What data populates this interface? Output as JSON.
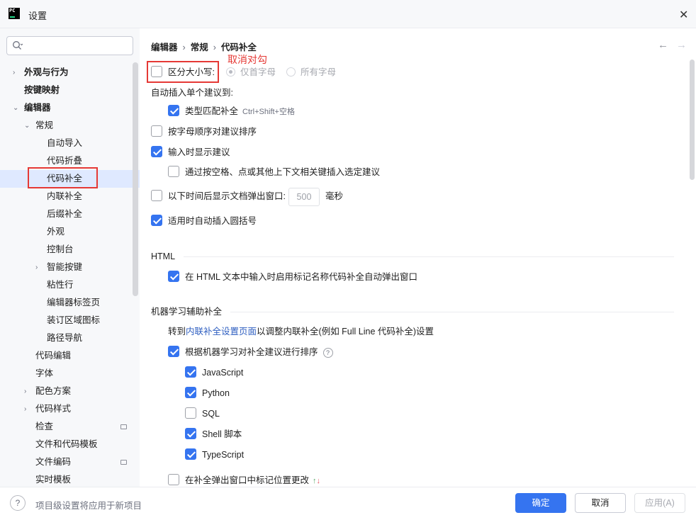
{
  "window": {
    "app_icon_text": "PC",
    "title": "设置"
  },
  "search": {
    "placeholder": "",
    "value": ""
  },
  "tree": [
    {
      "label": "外观与行为",
      "arrow": "›",
      "bold": true
    },
    {
      "label": "按键映射",
      "arrow": "",
      "bold": true
    },
    {
      "label": "编辑器",
      "arrow": "⌄",
      "bold": true
    },
    {
      "label": "常规",
      "arrow": "⌄",
      "bold": false
    },
    {
      "label": "自动导入",
      "arrow": "",
      "bold": false
    },
    {
      "label": "代码折叠",
      "arrow": "",
      "bold": false
    },
    {
      "label": "代码补全",
      "arrow": "",
      "bold": false,
      "selected": true
    },
    {
      "label": "内联补全",
      "arrow": "",
      "bold": false
    },
    {
      "label": "后缀补全",
      "arrow": "",
      "bold": false
    },
    {
      "label": "外观",
      "arrow": "",
      "bold": false
    },
    {
      "label": "控制台",
      "arrow": "",
      "bold": false
    },
    {
      "label": "智能按键",
      "arrow": "›",
      "bold": false
    },
    {
      "label": "粘性行",
      "arrow": "",
      "bold": false
    },
    {
      "label": "编辑器标签页",
      "arrow": "",
      "bold": false
    },
    {
      "label": "装订区域图标",
      "arrow": "",
      "bold": false
    },
    {
      "label": "路径导航",
      "arrow": "",
      "bold": false
    },
    {
      "label": "代码编辑",
      "arrow": "",
      "bold": false
    },
    {
      "label": "字体",
      "arrow": "",
      "bold": false
    },
    {
      "label": "配色方案",
      "arrow": "›",
      "bold": false
    },
    {
      "label": "代码样式",
      "arrow": "›",
      "bold": false
    },
    {
      "label": "检查",
      "arrow": "",
      "bold": false,
      "badge": true
    },
    {
      "label": "文件和代码模板",
      "arrow": "",
      "bold": false
    },
    {
      "label": "文件编码",
      "arrow": "",
      "bold": false,
      "badge": true
    },
    {
      "label": "实时模板",
      "arrow": "",
      "bold": false
    }
  ],
  "breadcrumb": {
    "part1": "编辑器",
    "part2": "常规",
    "part3": "代码补全",
    "sep": "›"
  },
  "annotation": "取消对勾",
  "case_sensitive": {
    "label": "区分大小写:",
    "checked": false,
    "opt1": "仅首字母",
    "opt2": "所有字母"
  },
  "auto_insert": {
    "label": "自动插入单个建议到:",
    "type_match": {
      "label": "类型匹配补全",
      "hint": "Ctrl+Shift+空格",
      "checked": true
    }
  },
  "sort_alpha": {
    "label": "按字母顺序对建议排序",
    "checked": false
  },
  "show_on_typing": {
    "label": "输入时显示建议",
    "checked": true
  },
  "insert_by_space": {
    "label": "通过按空格、点或其他上下文相关键插入选定建议",
    "checked": false
  },
  "doc_popup": {
    "label": "以下时间后显示文档弹出窗口:",
    "value": "500",
    "unit": "毫秒",
    "checked": false
  },
  "auto_paren": {
    "label": "适用时自动插入圆括号",
    "checked": true
  },
  "html_section": {
    "title": "HTML",
    "item": {
      "label": "在 HTML 文本中输入时启用标记名称代码补全自动弹出窗口",
      "checked": true
    }
  },
  "ml_section": {
    "title": "机器学习辅助补全",
    "goto_prefix": "转到",
    "goto_link": "内联补全设置页面",
    "goto_suffix": "以调整内联补全(例如 Full Line 代码补全)设置",
    "rank": {
      "label": "根据机器学习对补全建议进行排序",
      "help": "?",
      "checked": true
    },
    "langs": [
      {
        "label": "JavaScript",
        "checked": true
      },
      {
        "label": "Python",
        "checked": true
      },
      {
        "label": "SQL",
        "checked": false
      },
      {
        "label": "Shell 脚本",
        "checked": true
      },
      {
        "label": "TypeScript",
        "checked": true
      }
    ],
    "mark_pos": {
      "label": "在补全弹出窗口中标记位置更改",
      "checked": false
    }
  },
  "footer": {
    "note": "项目级设置将应用于新项目",
    "ok": "确定",
    "cancel": "取消",
    "apply": "应用(A)"
  }
}
